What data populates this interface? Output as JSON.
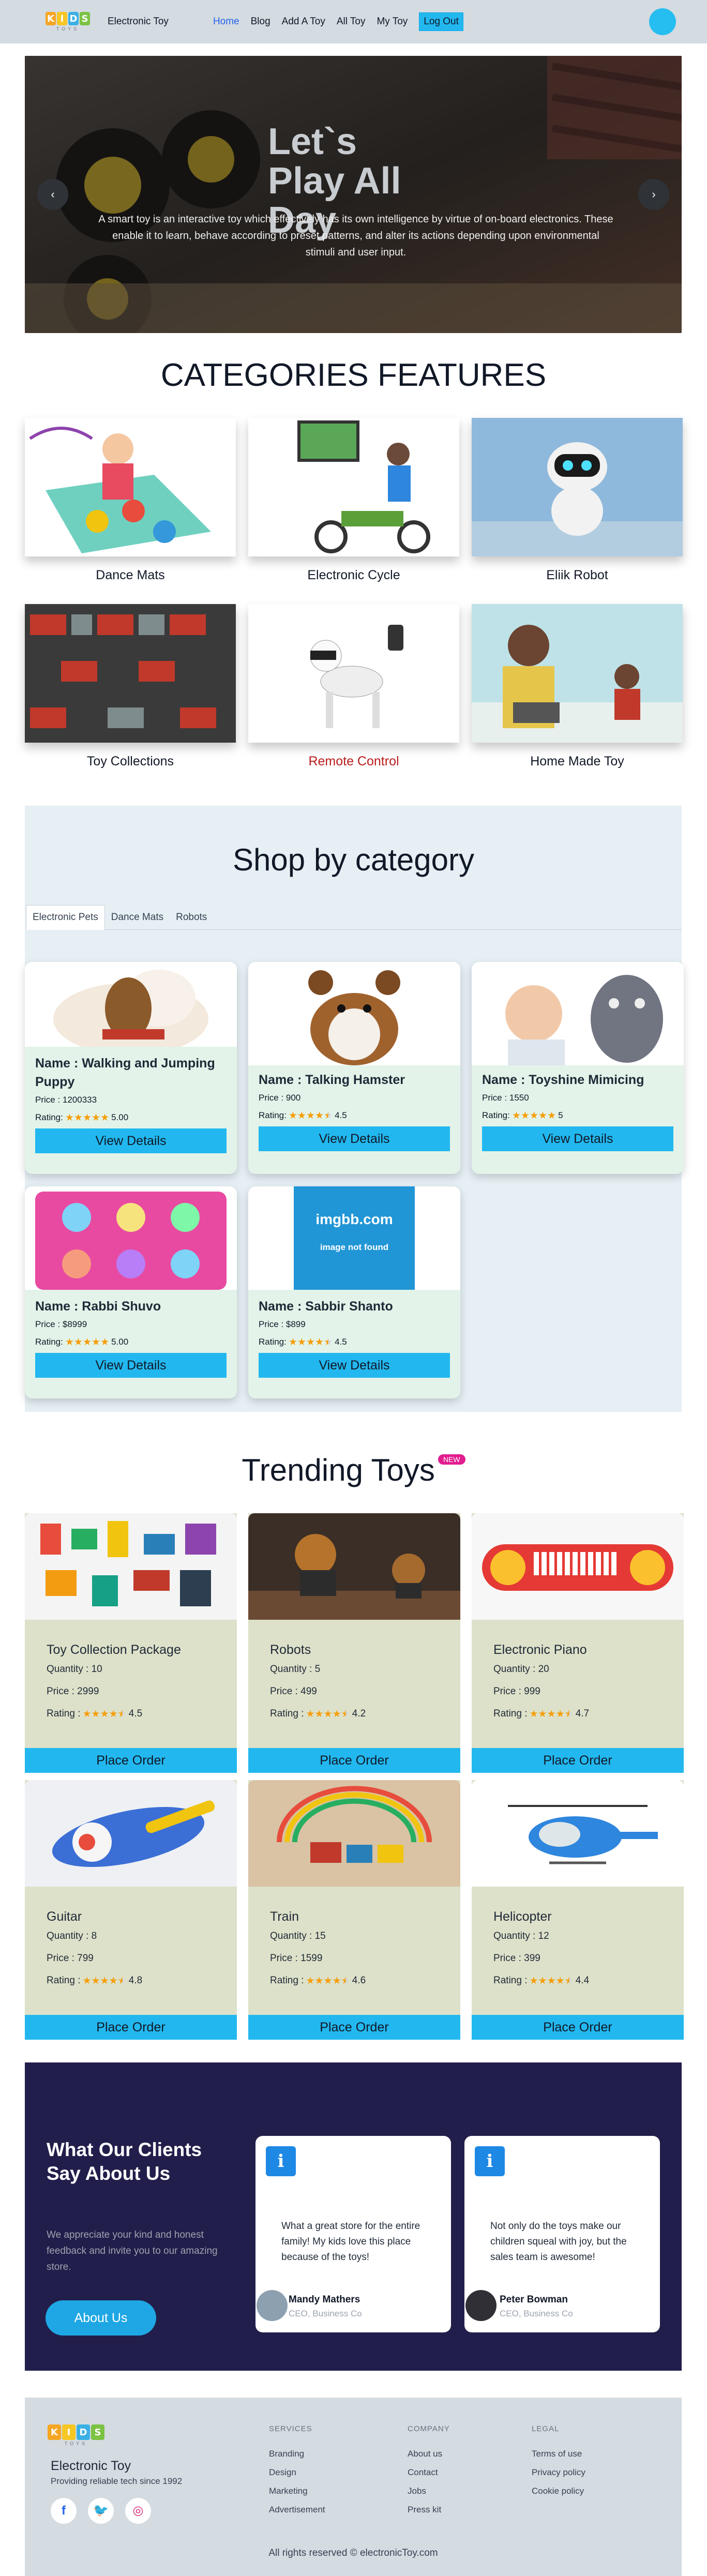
{
  "nav": {
    "logo_letters": [
      "K",
      "I",
      "D",
      "S"
    ],
    "logo_sub": "TOYS",
    "brand": "Electronic Toy",
    "links": [
      "Home",
      "Blog",
      "Add A Toy",
      "All Toy",
      "My Toy"
    ],
    "logout": "Log Out"
  },
  "hero": {
    "title": "Let`s Play All Day",
    "text": "A smart toy is an interactive toy which effectively has its own intelligence by virtue of on-board electronics. These enable it to learn, behave according to preset patterns, and alter its actions depending upon environmental stimuli and user input.",
    "prev": "‹",
    "next": "›"
  },
  "categories": {
    "title": "CATEGORIES FEATURES",
    "items": [
      "Dance Mats",
      "Electronic Cycle",
      "Eliik Robot",
      "Toy Collections",
      "Remote Control",
      "Home Made Toy"
    ]
  },
  "shop": {
    "title": "Shop by category",
    "tabs": [
      "Electronic Pets",
      "Dance Mats",
      "Robots"
    ],
    "products": [
      {
        "name": "Name : Walking and Jumping Puppy",
        "price": "Price : 1200333",
        "rating_label": "Rating:",
        "rating": "5.00",
        "stars": 5
      },
      {
        "name": "Name : Talking Hamster",
        "price": "Price : 900",
        "rating_label": "Rating:",
        "rating": "4.5",
        "stars": 4.5
      },
      {
        "name": "Name : Toyshine Mimicing",
        "price": "Price : 1550",
        "rating_label": "Rating:",
        "rating": "5",
        "stars": 5
      },
      {
        "name": "Name : Rabbi Shuvo",
        "price": "Price : $8999",
        "rating_label": "Rating:",
        "rating": "5.00",
        "stars": 5
      },
      {
        "name": "Name : Sabbir Shanto",
        "price": "Price : $899",
        "rating_label": "Rating:",
        "rating": "4.5",
        "stars": 4.5
      }
    ],
    "button": "View Details",
    "broken_image": {
      "title": "imgbb.com",
      "sub": "image not found"
    }
  },
  "trending": {
    "title": "Trending Toys",
    "badge": "NEW",
    "items": [
      {
        "name": "Toy Collection Package",
        "qty": "Quantity : 10",
        "price": "Price : 2999",
        "rating": "4.5",
        "stars": 4.5
      },
      {
        "name": "Robots",
        "qty": "Quantity : 5",
        "price": "Price : 499",
        "rating": "4.2",
        "stars": 4.2
      },
      {
        "name": "Electronic Piano",
        "qty": "Quantity : 20",
        "price": "Price : 999",
        "rating": "4.7",
        "stars": 4.7
      },
      {
        "name": "Guitar",
        "qty": "Quantity : 8",
        "price": "Price : 799",
        "rating": "4.8",
        "stars": 4.8
      },
      {
        "name": "Train",
        "qty": "Quantity : 15",
        "price": "Price : 1599",
        "rating": "4.6",
        "stars": 4.6
      },
      {
        "name": "Helicopter",
        "qty": "Quantity : 12",
        "price": "Price : 399",
        "rating": "4.4",
        "stars": 4.4
      }
    ],
    "rating_label": "Rating :",
    "button": "Place Order"
  },
  "testimonials": {
    "title": "What Our Clients Say About Us",
    "text": "We appreciate your kind and honest feedback and invite you to our amazing store.",
    "button": "About Us",
    "items": [
      {
        "quote": "What a great store for the entire family! My kids love this place because of the toys!",
        "name": "Mandy Mathers",
        "role": "CEO, Business Co"
      },
      {
        "quote": "Not only do the toys make our children squeal with joy, but the sales team is awesome!",
        "name": "Peter Bowman",
        "role": "CEO, Business Co"
      }
    ]
  },
  "footer": {
    "brand": "Electronic Toy",
    "tagline": "Providing reliable tech since 1992",
    "cols": [
      {
        "title": "SERVICES",
        "links": [
          "Branding",
          "Design",
          "Marketing",
          "Advertisement"
        ]
      },
      {
        "title": "COMPANY",
        "links": [
          "About us",
          "Contact",
          "Jobs",
          "Press kit"
        ]
      },
      {
        "title": "LEGAL",
        "links": [
          "Terms of use",
          "Privacy policy",
          "Cookie policy"
        ]
      }
    ],
    "copyright": "All rights reserved © electronicToy.com"
  },
  "colors": {
    "accent": "#22b8ef",
    "nav_bg": "#d4dbe1",
    "testimonial_bg": "#221e4b",
    "badge": "#e11d8f"
  }
}
